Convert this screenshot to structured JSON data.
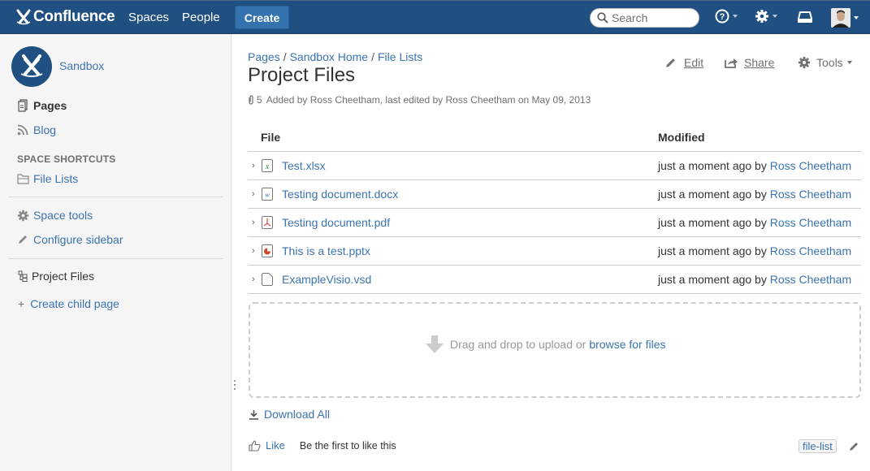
{
  "header": {
    "app_name": "Confluence",
    "nav": [
      "Spaces",
      "People"
    ],
    "create_label": "Create",
    "search_placeholder": "Search",
    "brand_color": "#205081",
    "icons": [
      "help-icon",
      "settings-icon",
      "notifications-inbox-icon",
      "user-avatar"
    ]
  },
  "sidebar": {
    "space_name": "Sandbox",
    "items": [
      {
        "label": "Pages",
        "icon": "pages-icon",
        "active": true
      },
      {
        "label": "Blog",
        "icon": "rss-icon",
        "active": false
      }
    ],
    "shortcuts_heading": "SPACE SHORTCUTS",
    "shortcuts": [
      {
        "label": "File Lists",
        "icon": "folder-icon"
      }
    ],
    "tools": [
      {
        "label": "Space tools",
        "icon": "gear-icon"
      },
      {
        "label": "Configure sidebar",
        "icon": "pencil-icon"
      }
    ],
    "tree": {
      "current_page": "Project Files",
      "create_child": "Create child page"
    }
  },
  "page": {
    "breadcrumb": [
      "Pages",
      "Sandbox Home",
      "File Lists"
    ],
    "breadcrumb_sep": "/",
    "title": "Project Files",
    "attachment_count": "5",
    "meta": "Added by Ross Cheetham, last edited by Ross Cheetham on May 09, 2013",
    "actions": {
      "edit": "Edit",
      "share": "Share",
      "tools": "Tools"
    }
  },
  "file_table": {
    "columns": [
      "File",
      "Modified"
    ],
    "rows": [
      {
        "name": "Test.xlsx",
        "type": "excel",
        "modified": "just a moment ago by",
        "author": "Ross Cheetham"
      },
      {
        "name": "Testing document.docx",
        "type": "word",
        "modified": "just a moment ago by",
        "author": "Ross Cheetham"
      },
      {
        "name": "Testing document.pdf",
        "type": "pdf",
        "modified": "just a moment ago by",
        "author": "Ross Cheetham"
      },
      {
        "name": "This is a test.pptx",
        "type": "powerpoint",
        "modified": "just a moment ago by",
        "author": "Ross Cheetham"
      },
      {
        "name": "ExampleVisio.vsd",
        "type": "generic",
        "modified": "just a moment ago by",
        "author": "Ross Cheetham"
      }
    ]
  },
  "dropzone": {
    "text": "Drag and drop to upload or",
    "link": "browse for files"
  },
  "download_all": "Download All",
  "like": {
    "label": "Like",
    "text": "Be the first to like this"
  },
  "labels": [
    "file-list"
  ]
}
